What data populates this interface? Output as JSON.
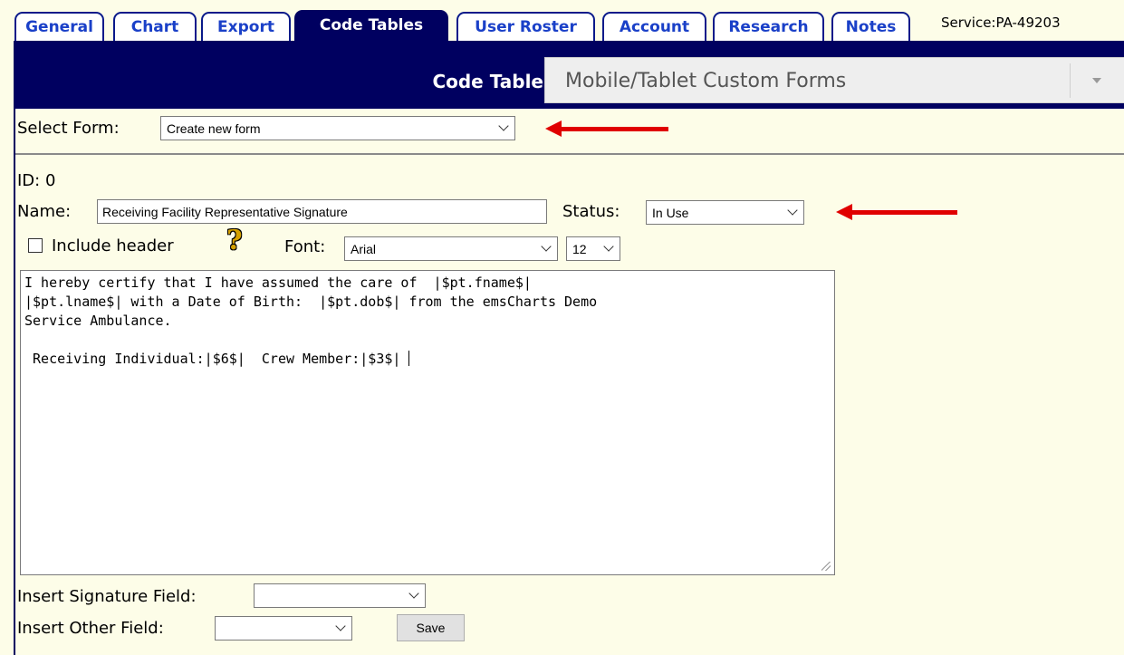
{
  "tabs": [
    {
      "label": "General"
    },
    {
      "label": "Chart"
    },
    {
      "label": "Export"
    },
    {
      "label": "Code Tables",
      "active": true
    },
    {
      "label": "User Roster"
    },
    {
      "label": "Account"
    },
    {
      "label": "Research"
    },
    {
      "label": "Notes"
    }
  ],
  "service_id": "Service:PA-49203",
  "code_table": {
    "label": "Code Table:",
    "value": "Mobile/Tablet Custom Forms"
  },
  "select_form": {
    "label": "Select Form:",
    "value": "Create new form"
  },
  "form": {
    "id_text": "ID: 0",
    "name_label": "Name:",
    "name_value": "Receiving Facility Representative Signature",
    "status_label": "Status:",
    "status_value": "In Use",
    "include_header_label": "Include header",
    "include_header_checked": false,
    "help_symbol": "?",
    "font_label": "Font:",
    "font_value": "Arial",
    "size_value": "12",
    "body_text": "I hereby certify that I have assumed the care of  |$pt.fname$|\n|$pt.lname$| with a Date of Birth:  |$pt.dob$| from the emsCharts Demo\nService Ambulance.\n\n Receiving Individual:|$6$|  Crew Member:|$3$| ",
    "insert_signature_label": "Insert Signature Field:",
    "insert_signature_value": "",
    "insert_other_label": "Insert Other Field:",
    "insert_other_value": "",
    "save_label": "Save"
  },
  "colors": {
    "page_bg": "#fdfde8",
    "header_navy": "#000060",
    "tab_text": "#1a40c8",
    "arrow_red": "#e00000"
  }
}
